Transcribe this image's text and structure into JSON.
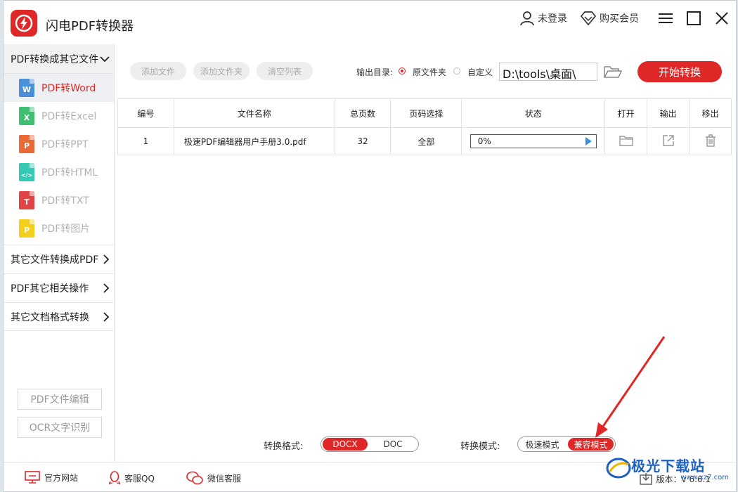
{
  "app": {
    "title": "闪电PDF转换器"
  },
  "titlebar": {
    "login": "未登录",
    "buy_vip": "购买会员"
  },
  "sidebar": {
    "section_open": "PDF转换成其它文件",
    "items": [
      {
        "label": "PDF转Word",
        "icon_text": "W",
        "icon_color": "#4a90d9"
      },
      {
        "label": "PDF转Excel",
        "icon_text": "X",
        "icon_color": "#3fbf6f"
      },
      {
        "label": "PDF转PPT",
        "icon_text": "P",
        "icon_color": "#ea6a36"
      },
      {
        "label": "PDF转HTML",
        "icon_text": "</>",
        "icon_color": "#33c9b5"
      },
      {
        "label": "PDF转TXT",
        "icon_text": "T",
        "icon_color": "#e04444"
      },
      {
        "label": "PDF转图片",
        "icon_text": "P",
        "icon_color": "#f2cf1d"
      }
    ],
    "categories": [
      "其它文件转换成PDF",
      "PDF其它相关操作",
      "其它文档格式转换"
    ],
    "buttons": {
      "pdf_edit": "PDF文件编辑",
      "ocr": "OCR文字识别"
    }
  },
  "toolbar": {
    "add_file": "添加文件",
    "add_folder": "添加文件夹",
    "clear_list": "清空列表",
    "output_label": "输出目录:",
    "opt_original": "原文件夹",
    "opt_custom": "自定义",
    "path": "D:\\tools\\桌面\\",
    "start": "开始转换"
  },
  "table": {
    "headers": [
      "编号",
      "文件名称",
      "总页数",
      "页码选择",
      "状态",
      "打开",
      "输出",
      "移出"
    ],
    "rows": [
      {
        "num": "1",
        "name": "极速PDF编辑器用户手册3.0.pdf",
        "pages": "32",
        "range": "全部",
        "progress": "0%"
      }
    ]
  },
  "format": {
    "label": "转换格式:",
    "options": [
      "DOCX",
      "DOC"
    ],
    "selected": "DOCX"
  },
  "mode": {
    "label": "转换模式:",
    "options": [
      "极速模式",
      "兼容模式"
    ],
    "selected": "兼容模式"
  },
  "footer": {
    "site": "官方网站",
    "qq": "客服QQ",
    "wechat": "微信客服",
    "version": "版本：v 6.6.1"
  },
  "watermark": {
    "name": "极光下载站",
    "url": "www.xz7.com"
  },
  "colors": {
    "accent": "#e02727",
    "progress_arrow": "#3b8fe0"
  }
}
